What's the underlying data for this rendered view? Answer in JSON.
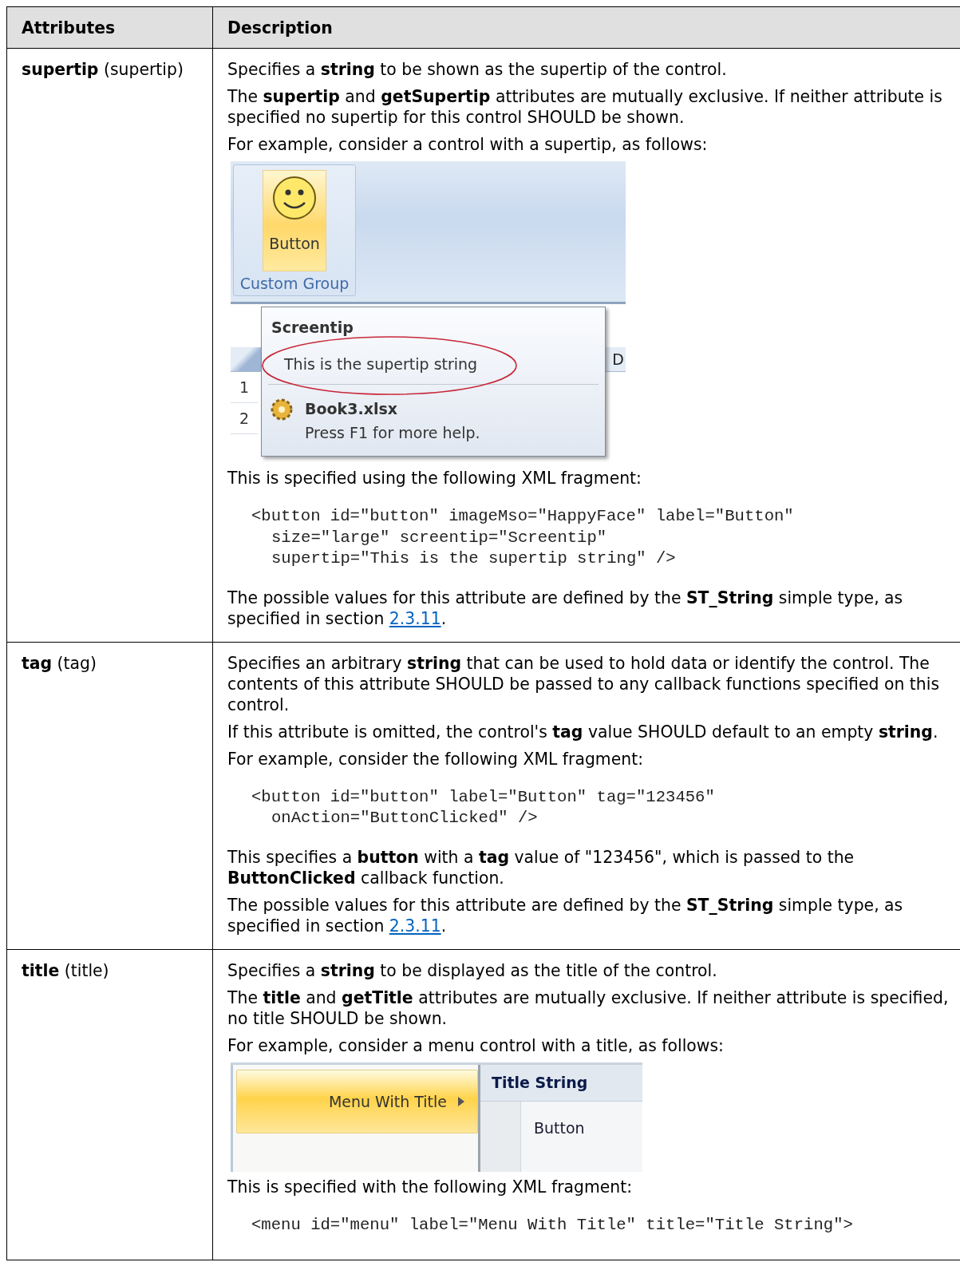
{
  "table": {
    "columns": [
      "Attributes",
      "Description"
    ],
    "rows": [
      {
        "attribute": "**supertip** (supertip)",
        "description": [
          {
            "kind": "text",
            "text": "Specifies a **string** to be shown as the supertip of the control."
          },
          {
            "kind": "text",
            "text": "The **supertip** and **getSupertip** attributes are mutually exclusive. If neither attribute is specified no supertip for this control SHOULD be shown."
          },
          {
            "kind": "text",
            "text": "For example, consider a control with a supertip, as follows:"
          },
          {
            "kind": "supertip_figure",
            "button_label": "Button",
            "group_label": "Custom Group",
            "screentip_title": "Screentip",
            "supertip": "This is the supertip string",
            "file_name": "Book3.xlsx",
            "help_text": "Press F1 for more help.",
            "row_numbers": [
              "1",
              "2"
            ],
            "column_header": "D"
          },
          {
            "kind": "text",
            "text": "This is specified using the following XML fragment:"
          },
          {
            "kind": "code",
            "lines": [
              "<button id=\"button\" imageMso=\"HappyFace\" label=\"Button\"",
              "size=\"large\" screentip=\"Screentip\"",
              "supertip=\"This is the supertip string\" />"
            ]
          },
          {
            "kind": "ref",
            "text": "The possible values for this attribute are defined by the **ST_String** simple type, as specified in section",
            "link": "2.3.11",
            "after": "."
          }
        ]
      },
      {
        "attribute": "**tag** (tag)",
        "description": [
          {
            "kind": "text",
            "text": "Specifies an arbitrary **string** that can be used to hold data or identify the control. The contents of this attribute SHOULD be passed to any callback functions specified on this control."
          },
          {
            "kind": "text",
            "text": "If this attribute is omitted, the control's **tag** value SHOULD default to an empty **string**."
          },
          {
            "kind": "text",
            "text": "For example, consider the following XML fragment:"
          },
          {
            "kind": "code",
            "lines": [
              "<button id=\"button\" label=\"Button\" tag=\"123456\"",
              "onAction=\"ButtonClicked\" />"
            ]
          },
          {
            "kind": "text",
            "text": "This specifies a **button** with a **tag** value of \"123456\", which is passed to the **ButtonClicked** callback function."
          },
          {
            "kind": "ref",
            "text": "The possible values for this attribute are defined by the **ST_String** simple type, as specified in section",
            "link": "2.3.11",
            "after": "."
          }
        ]
      },
      {
        "attribute": "**title** (title)",
        "description": [
          {
            "kind": "text",
            "text": "Specifies a **string** to be displayed as the title of the control."
          },
          {
            "kind": "text",
            "text": "The **title** and **getTitle** attributes are mutually exclusive. If neither attribute is specified, no title SHOULD be shown."
          },
          {
            "kind": "text",
            "text": "For example, consider a menu control with a title, as follows:"
          },
          {
            "kind": "menu_figure",
            "menu_label": "Menu With Title",
            "title": "Title String",
            "button_label": "Button"
          },
          {
            "kind": "text",
            "text": "This is specified with the following XML fragment:"
          },
          {
            "kind": "code",
            "lines": [
              "<menu id=\"menu\" label=\"Menu With Title\" title=\"Title String\">"
            ]
          }
        ]
      }
    ]
  }
}
